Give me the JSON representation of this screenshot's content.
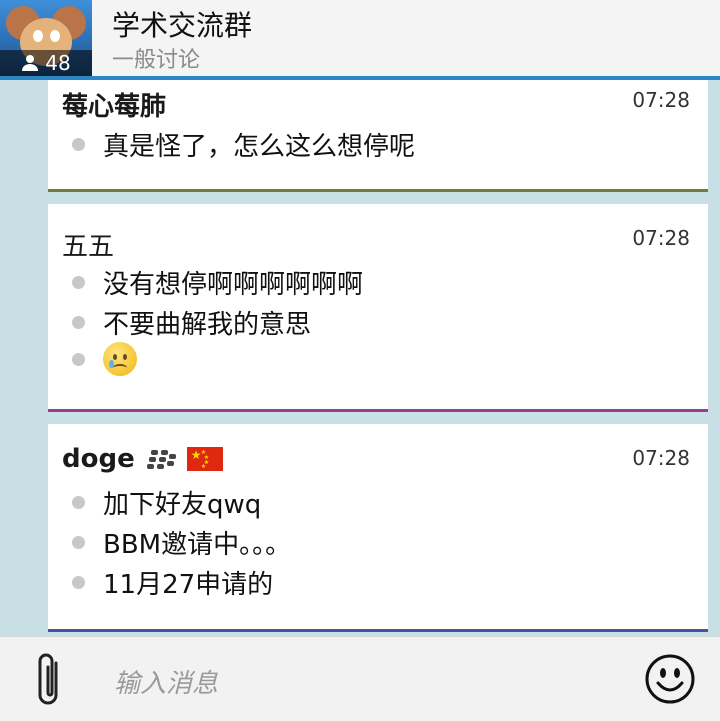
{
  "header": {
    "title": "学术交流群",
    "subtitle": "一般讨论",
    "member_count": "48"
  },
  "messages": [
    {
      "sender": "莓心莓肺",
      "time": "07:28",
      "accent": "#6b7f3a",
      "lines": [
        "真是怪了，怎么这么想停呢"
      ]
    },
    {
      "sender": "五五",
      "time": "07:28",
      "accent": "#9b3c8e",
      "lines": [
        "没有想停啊啊啊啊啊啊",
        "不要曲解我的意思"
      ],
      "emoji": "crying-face"
    },
    {
      "sender": "doge",
      "time": "07:28",
      "accent": "#4b4fa0",
      "lines": [
        "加下好友qwq",
        "BBM邀请中。。。",
        "11月27申请的"
      ],
      "badges": [
        "blackberry-icon",
        "china-flag-icon"
      ]
    }
  ],
  "composer": {
    "placeholder": "输入消息"
  }
}
